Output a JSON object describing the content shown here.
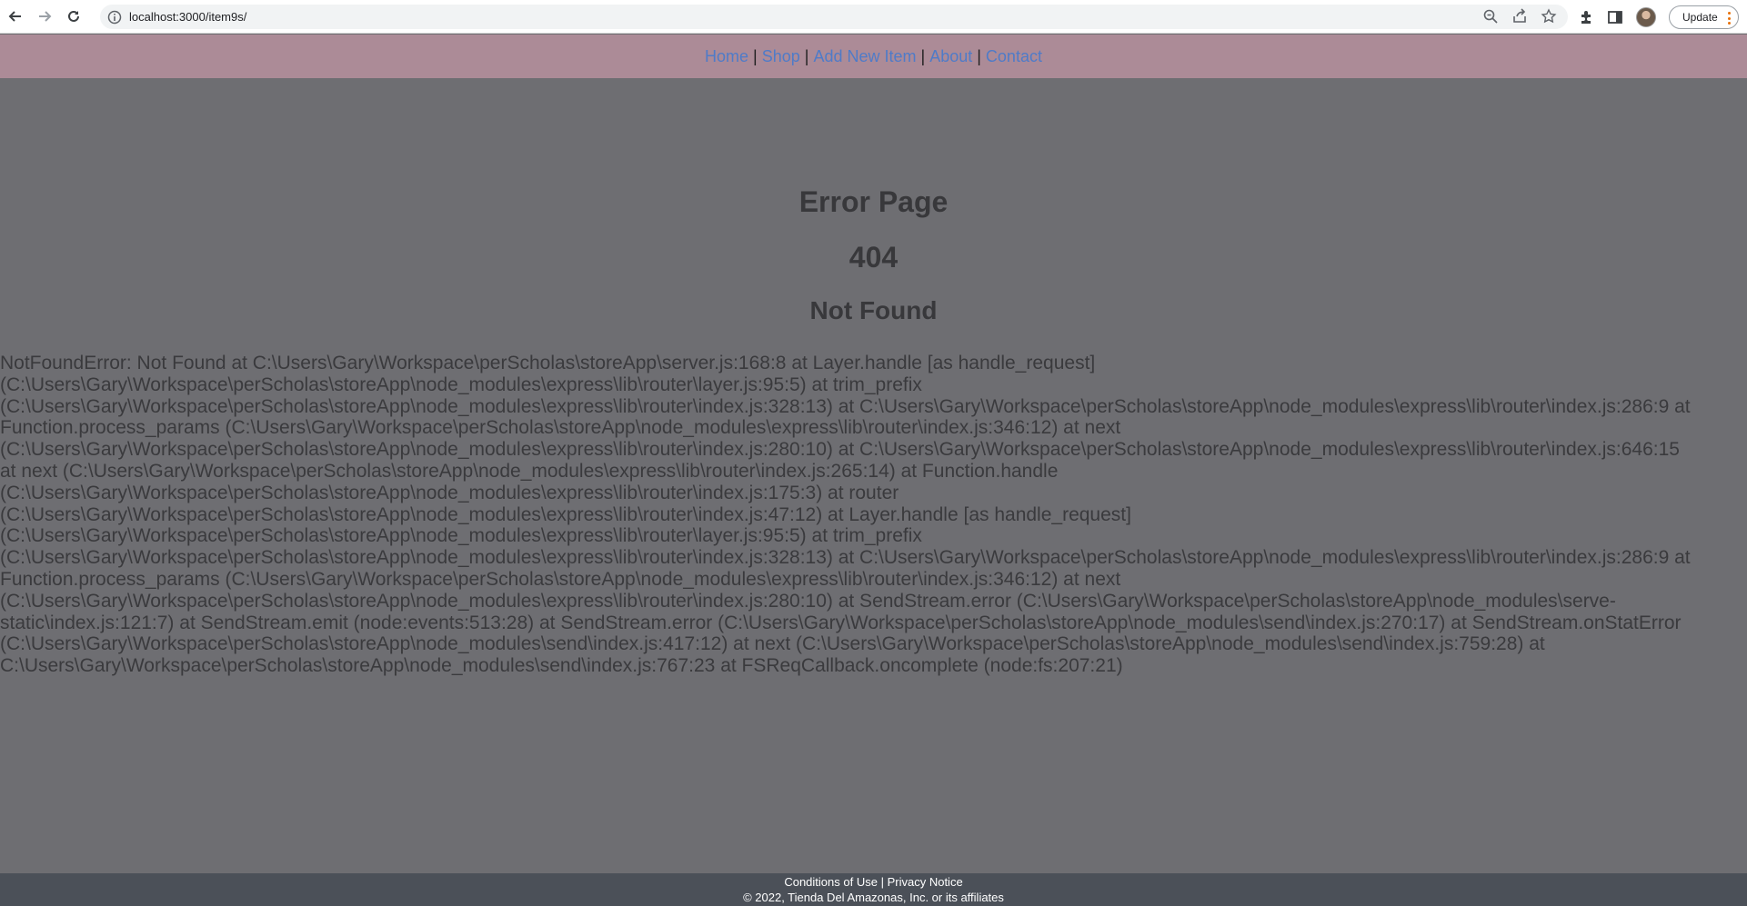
{
  "browser": {
    "url": "localhost:3000/item9s/",
    "update_label": "Update",
    "icons": [
      "back-icon",
      "forward-icon",
      "reload-icon",
      "info-icon",
      "zoom-icon",
      "share-icon",
      "bookmark-star-icon",
      "extensions-icon",
      "side-panel-icon",
      "profile-avatar",
      "menu-dots-icon"
    ]
  },
  "nav": {
    "links": [
      "Home",
      "Shop",
      "Add New Item",
      "About",
      "Contact"
    ],
    "separator": "|"
  },
  "error": {
    "title": "Error Page",
    "code": "404",
    "message": "Not Found",
    "stack": [
      "NotFoundError: Not Found at C:\\Users\\Gary\\Workspace\\perScholas\\storeApp\\server.js:168:8 at Layer.handle [as handle_request]",
      "(C:\\Users\\Gary\\Workspace\\perScholas\\storeApp\\node_modules\\express\\lib\\router\\layer.js:95:5) at trim_prefix",
      "(C:\\Users\\Gary\\Workspace\\perScholas\\storeApp\\node_modules\\express\\lib\\router\\index.js:328:13) at C:\\Users\\Gary\\Workspace\\perScholas\\storeApp\\node_modules\\express\\lib\\router\\index.js:286:9 at",
      "Function.process_params (C:\\Users\\Gary\\Workspace\\perScholas\\storeApp\\node_modules\\express\\lib\\router\\index.js:346:12) at next",
      "(C:\\Users\\Gary\\Workspace\\perScholas\\storeApp\\node_modules\\express\\lib\\router\\index.js:280:10) at C:\\Users\\Gary\\Workspace\\perScholas\\storeApp\\node_modules\\express\\lib\\router\\index.js:646:15",
      "at next (C:\\Users\\Gary\\Workspace\\perScholas\\storeApp\\node_modules\\express\\lib\\router\\index.js:265:14) at Function.handle",
      "(C:\\Users\\Gary\\Workspace\\perScholas\\storeApp\\node_modules\\express\\lib\\router\\index.js:175:3) at router",
      "(C:\\Users\\Gary\\Workspace\\perScholas\\storeApp\\node_modules\\express\\lib\\router\\index.js:47:12) at Layer.handle [as handle_request]",
      "(C:\\Users\\Gary\\Workspace\\perScholas\\storeApp\\node_modules\\express\\lib\\router\\layer.js:95:5) at trim_prefix",
      "(C:\\Users\\Gary\\Workspace\\perScholas\\storeApp\\node_modules\\express\\lib\\router\\index.js:328:13) at C:\\Users\\Gary\\Workspace\\perScholas\\storeApp\\node_modules\\express\\lib\\router\\index.js:286:9 at",
      "Function.process_params (C:\\Users\\Gary\\Workspace\\perScholas\\storeApp\\node_modules\\express\\lib\\router\\index.js:346:12) at next",
      "(C:\\Users\\Gary\\Workspace\\perScholas\\storeApp\\node_modules\\express\\lib\\router\\index.js:280:10) at SendStream.error (C:\\Users\\Gary\\Workspace\\perScholas\\storeApp\\node_modules\\serve-",
      "static\\index.js:121:7) at SendStream.emit (node:events:513:28) at SendStream.error (C:\\Users\\Gary\\Workspace\\perScholas\\storeApp\\node_modules\\send\\index.js:270:17) at SendStream.onStatError",
      "(C:\\Users\\Gary\\Workspace\\perScholas\\storeApp\\node_modules\\send\\index.js:417:12) at next (C:\\Users\\Gary\\Workspace\\perScholas\\storeApp\\node_modules\\send\\index.js:759:28) at",
      "C:\\Users\\Gary\\Workspace\\perScholas\\storeApp\\node_modules\\send\\index.js:767:23 at FSReqCallback.oncomplete (node:fs:207:21)"
    ]
  },
  "footer": {
    "conditions": "Conditions of Use",
    "separator": "|",
    "privacy": "Privacy Notice",
    "copyright": "© 2022, Tienda Del Amazonas, Inc. or its affiliates"
  },
  "colors": {
    "nav_bg": "#ac8b97",
    "link": "#4f7bc8",
    "main_bg": "#6e6e72",
    "footer_bg": "#4b5058",
    "update_dots": "#e8710a"
  }
}
